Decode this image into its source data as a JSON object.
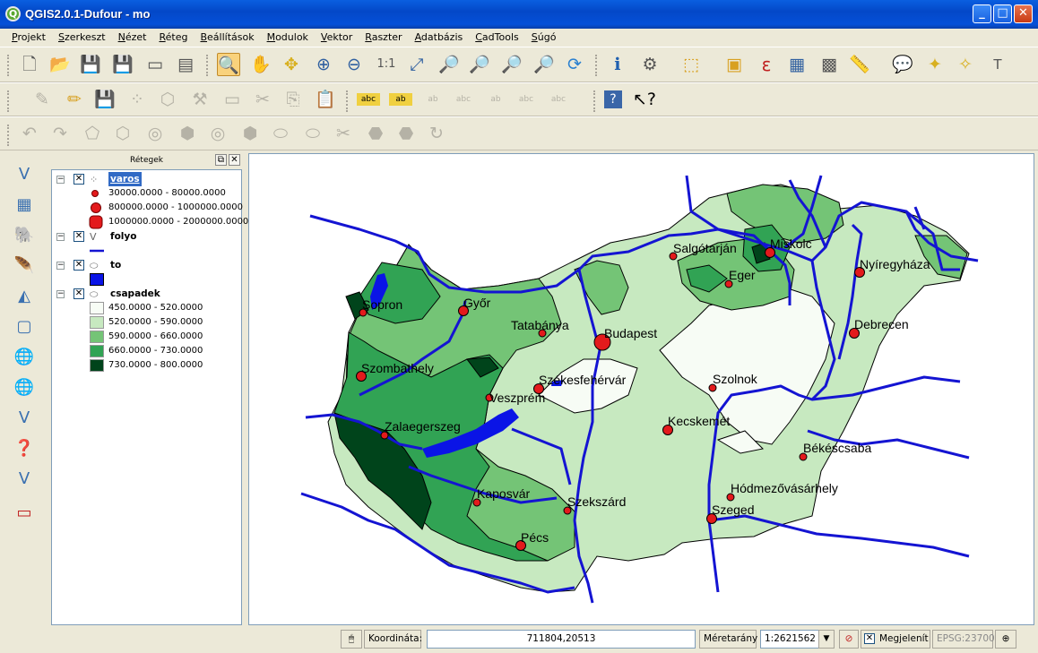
{
  "window": {
    "title": "QGIS2.0.1-Dufour - mo"
  },
  "menu": [
    "Projekt",
    "Szerkeszt",
    "Nézet",
    "Réteg",
    "Beállítások",
    "Modulok",
    "Vektor",
    "Raszter",
    "Adatbázis",
    "CadTools",
    "Súgó"
  ],
  "layers_panel": {
    "title": "Rétegek",
    "layers": [
      {
        "name": "varos",
        "selected": true,
        "classes": [
          "30000.0000 - 80000.0000",
          "800000.0000 - 1000000.0000",
          "1000000.0000 - 2000000.0000"
        ]
      },
      {
        "name": "folyo",
        "selected": false,
        "classes": []
      },
      {
        "name": "to",
        "selected": false,
        "classes": []
      },
      {
        "name": "csapadek",
        "selected": false,
        "classes": [
          "450.0000 - 520.0000",
          "520.0000 - 590.0000",
          "590.0000 - 660.0000",
          "660.0000 - 730.0000",
          "730.0000 - 800.0000"
        ]
      }
    ],
    "legend_colors": {
      "point": "#e31a1c",
      "river": "#1414d2",
      "lake": "#0a14e6",
      "ramp": [
        "#f7fcf5",
        "#c7e9c0",
        "#74c476",
        "#31a354",
        "#00441b"
      ]
    }
  },
  "map": {
    "cities": [
      "Sopron",
      "Győr",
      "Tatabánya",
      "Budapest",
      "Salgótarján",
      "Miskolc",
      "Eger",
      "Nyíregyháza",
      "Debrecen",
      "Szombathely",
      "Székesfehérvár",
      "Veszprém",
      "Szolnok",
      "Zalaegerszeg",
      "Kecskemét",
      "Békéscsaba",
      "Kaposvár",
      "Szekszárd",
      "Hódmezővásárhely",
      "Szeged",
      "Pécs"
    ]
  },
  "status": {
    "coord_label": "Koordináta:",
    "coord_value": "711804,20513",
    "scale_label": "Méretarány",
    "scale_value": "1:2621562",
    "render_label": "Megjelenít",
    "crs": "EPSG:23700"
  }
}
